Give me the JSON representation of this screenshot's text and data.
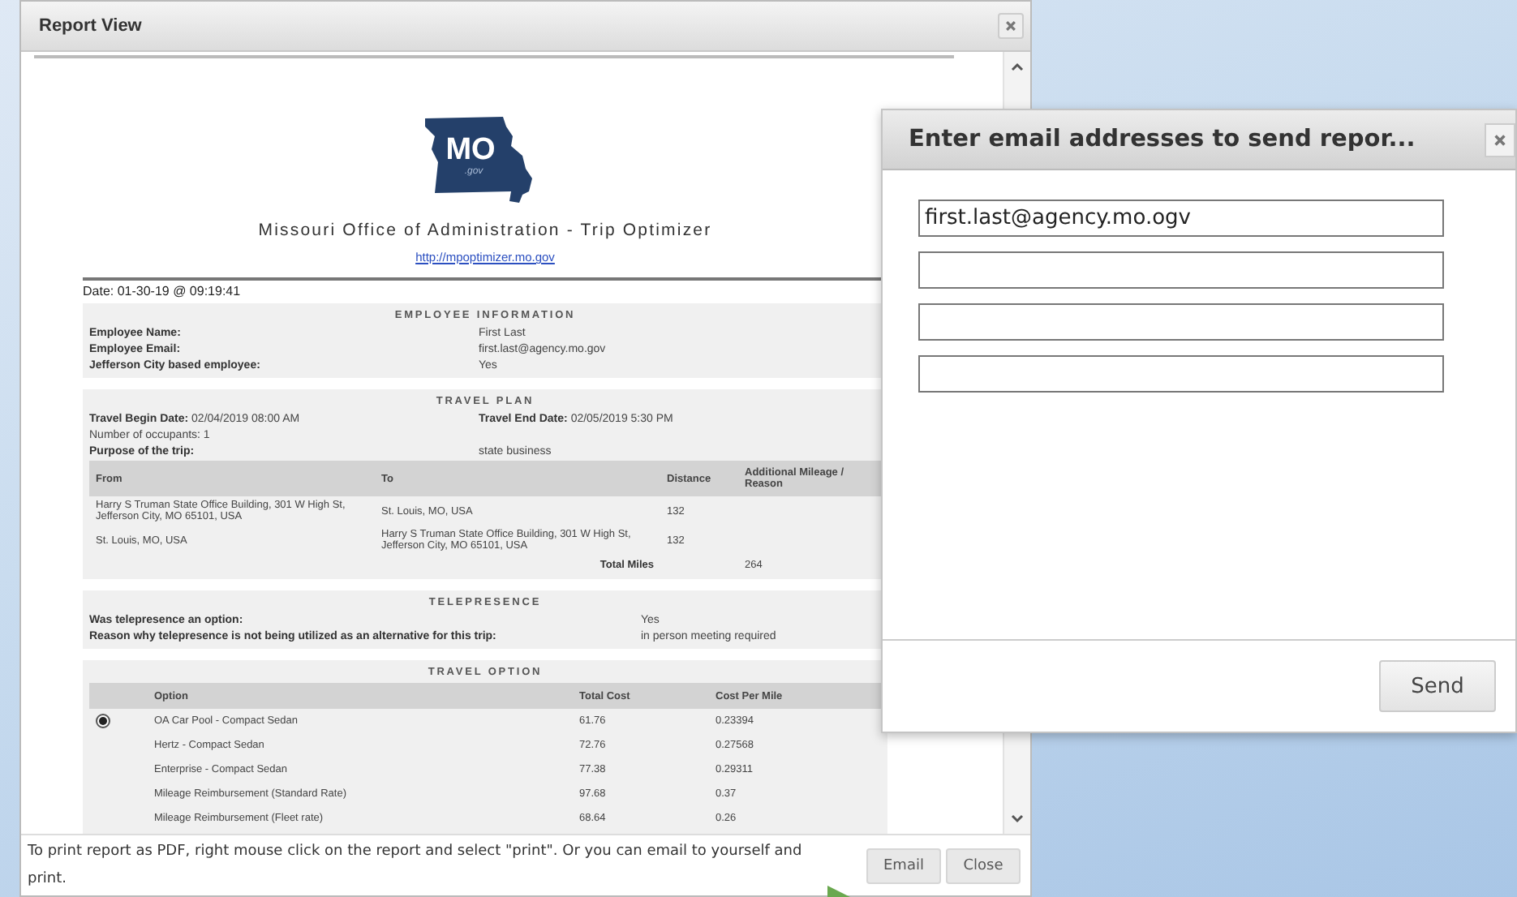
{
  "report_window": {
    "title": "Report View"
  },
  "report": {
    "logo": {
      "text": "MO",
      "subtext": ".gov"
    },
    "heading": "Missouri Office of Administration - Trip Optimizer",
    "link": "http://mpoptimizer.mo.gov",
    "date": "Date: 01-30-19 @ 09:19:41",
    "employee_information": {
      "title": "EMPLOYEE INFORMATION",
      "rows": [
        {
          "label": "Employee Name:",
          "value": "First Last"
        },
        {
          "label": "Employee Email:",
          "value": "first.last@agency.mo.gov"
        },
        {
          "label": "Jefferson City based employee:",
          "value": "Yes"
        }
      ]
    },
    "travel_plan": {
      "title": "TRAVEL PLAN",
      "begin_label": "Travel Begin Date:",
      "begin_value": "02/04/2019 08:00 AM",
      "end_label": "Travel End Date:",
      "end_value": "02/05/2019 5:30 PM",
      "occupants": "Number of occupants: 1",
      "purpose_label": "Purpose of the trip:",
      "purpose_value": "state business",
      "columns": [
        "From",
        "To",
        "Distance",
        "Additional Mileage / Reason"
      ],
      "rows": [
        [
          "Harry S Truman State Office Building, 301 W High St, Jefferson City, MO 65101, USA",
          "St. Louis, MO, USA",
          "132"
        ],
        [
          "St. Louis, MO, USA",
          "Harry S Truman State Office Building, 301 W High St, Jefferson City, MO 65101, USA",
          "132"
        ]
      ],
      "total_label": "Total Miles",
      "total_value": "264"
    },
    "telepresence": {
      "title": "TELEPRESENCE",
      "rows": [
        {
          "label": "Was telepresence an option:",
          "value": "Yes"
        },
        {
          "label": "Reason why telepresence is not being utilized as an alternative for this trip:",
          "value": "in person meeting required"
        }
      ]
    },
    "travel_option": {
      "title": "TRAVEL OPTION",
      "columns": [
        "Option",
        "Total Cost",
        "Cost Per Mile"
      ],
      "rows": [
        {
          "option": "OA Car Pool - Compact Sedan",
          "total_cost": "61.76",
          "cost_per_mile": "0.23394",
          "selected": true
        },
        {
          "option": "Hertz - Compact Sedan",
          "total_cost": "72.76",
          "cost_per_mile": "0.27568",
          "selected": false
        },
        {
          "option": "Enterprise - Compact Sedan",
          "total_cost": "77.38",
          "cost_per_mile": "0.29311",
          "selected": false
        },
        {
          "option": "Mileage Reimbursement (Standard Rate)",
          "total_cost": "97.68",
          "cost_per_mile": "0.37",
          "selected": false
        },
        {
          "option": "Mileage Reimbursement (Fleet rate)",
          "total_cost": "68.64",
          "cost_per_mile": "0.26",
          "selected": false
        }
      ]
    }
  },
  "footer_note": "To print report as PDF, right mouse click on the report and select \"print\". Or you can email to yourself and print.",
  "buttons": [
    "Email",
    "Close"
  ],
  "email_dialog": {
    "title": "Enter email addresses to send repor...",
    "fields": [
      {
        "kind": "filled",
        "value": "first.last@agency.mo.ogv"
      },
      {
        "kind": "empty"
      },
      {
        "kind": "empty"
      },
      {
        "kind": "empty"
      }
    ],
    "send_button": "Send"
  }
}
